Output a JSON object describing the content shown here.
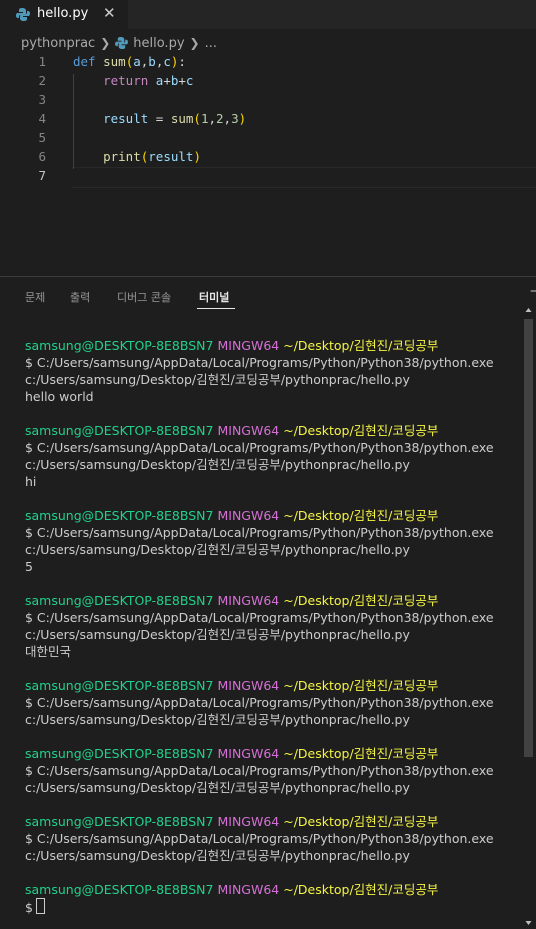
{
  "tab": {
    "filename": "hello.py",
    "close_glyph": "✕"
  },
  "breadcrumb": {
    "folder": "pythonprac",
    "file": "hello.py",
    "more": "..."
  },
  "editor": {
    "line_numbers": [
      "1",
      "2",
      "3",
      "4",
      "5",
      "6",
      "7"
    ],
    "active_line": 7
  },
  "panel": {
    "tabs": [
      "문제",
      "출력",
      "디버그 콘솔",
      "터미널"
    ],
    "active_tab": "터미널",
    "menu_glyph": "—"
  },
  "terminal": {
    "prompt_user": "samsung@DESKTOP-8E8BSN7",
    "prompt_env": "MINGW64",
    "prompt_path": "~/Desktop/김현진/코딩공부",
    "command_line1": "$ C:/Users/samsung/AppData/Local/Programs/Python/Python38/python.exe",
    "command_line2": "c:/Users/samsung/Desktop/김현진/코딩공부/pythonprac/hello.py",
    "outputs": [
      "hello world",
      "hi",
      "5",
      "대한민국",
      "",
      ""
    ],
    "final_prompt": "$"
  },
  "colors": {
    "background": "#1e1e1e",
    "prompt_user": "#23d18b",
    "prompt_env": "#d670d6",
    "prompt_path": "#f5f543",
    "python_icon": "#519aba"
  },
  "icons": {
    "file_icon": "python-icon",
    "close_icon": "close-icon",
    "panel_menu": "minimize-icon"
  }
}
